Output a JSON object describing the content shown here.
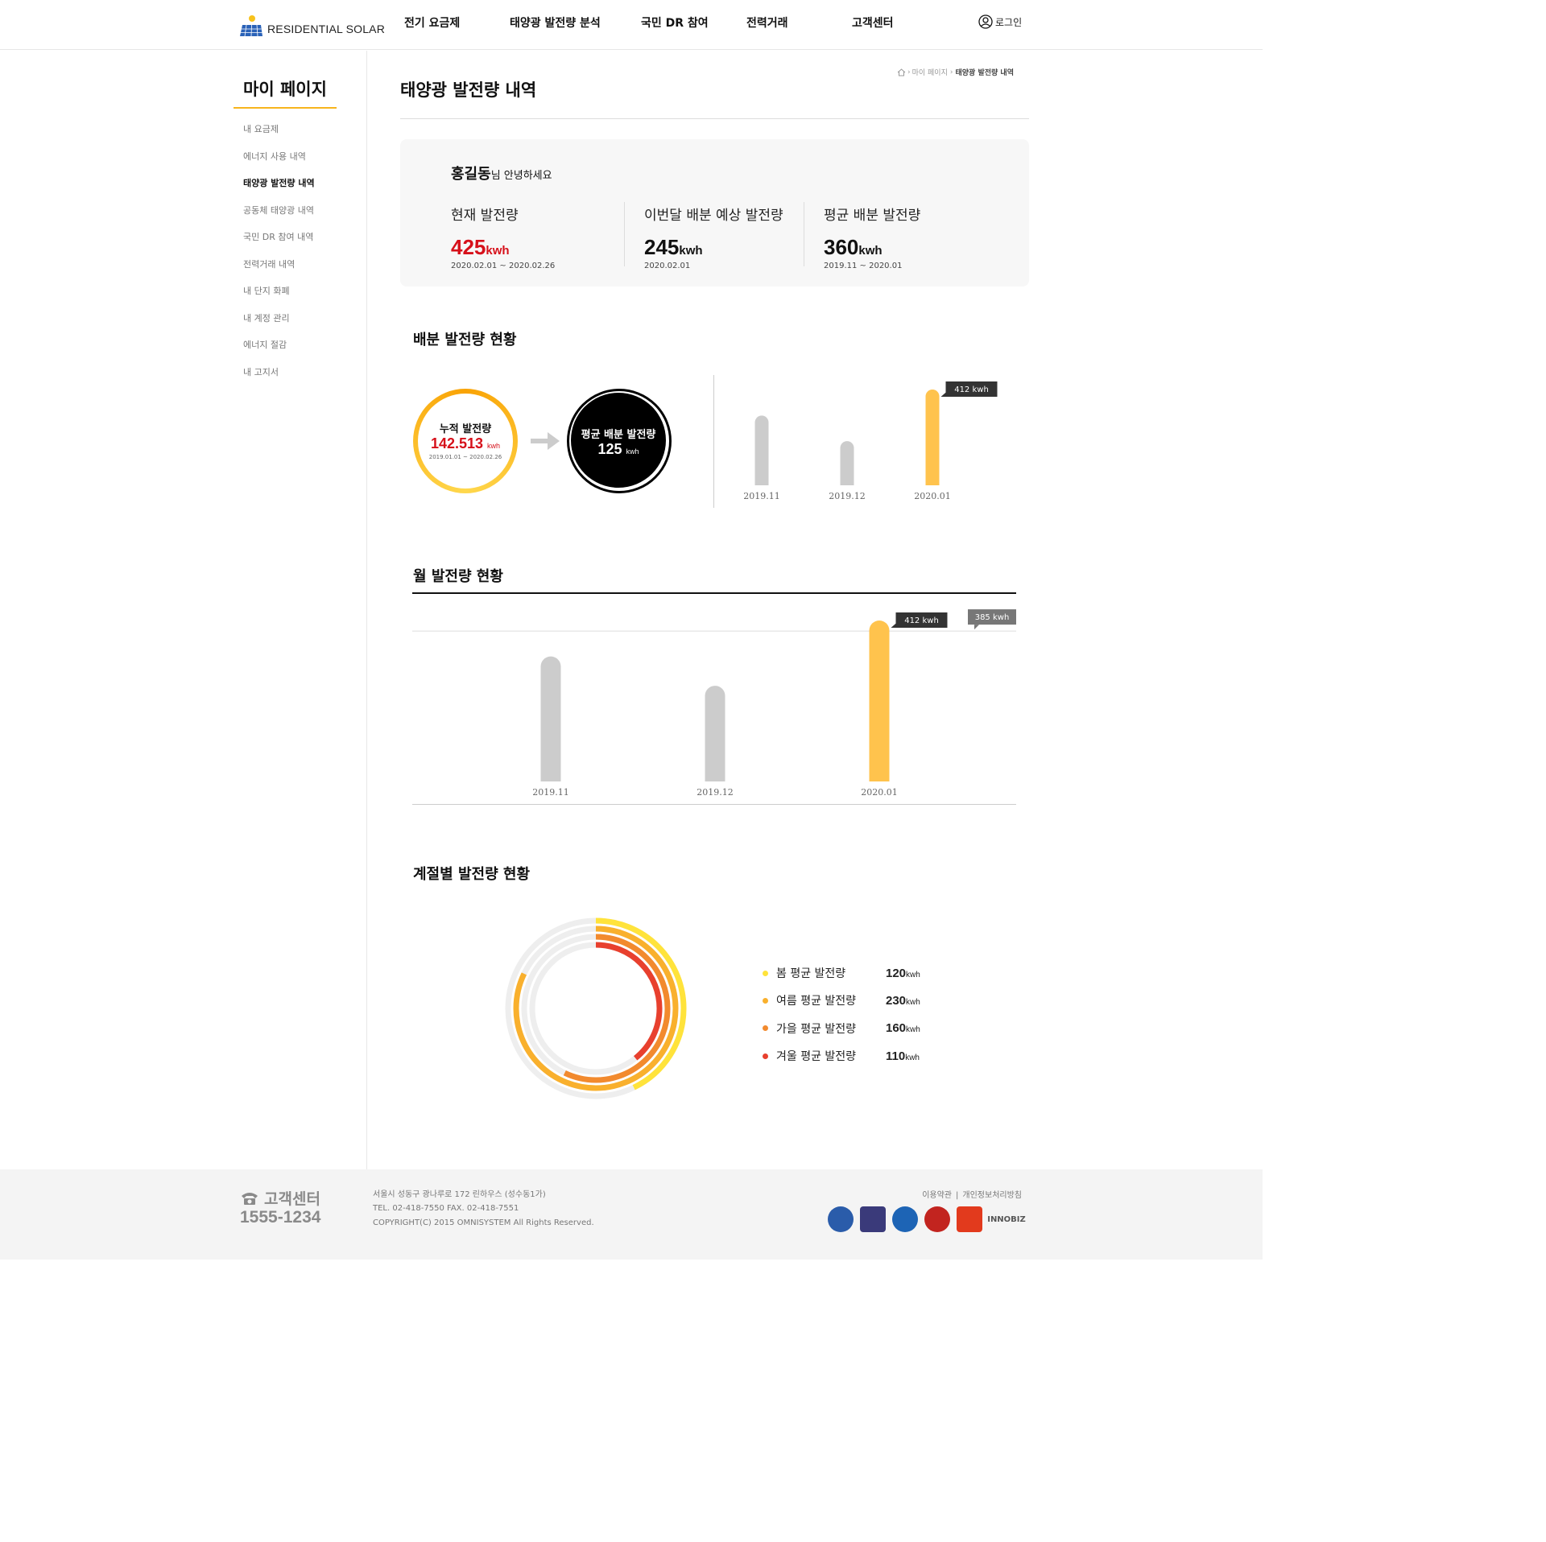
{
  "header": {
    "logo_text": "RESIDENTIAL SOLAR",
    "nav": [
      "전기 요금제",
      "태양광 발전량 분석",
      "국민 DR 참여",
      "전력거래",
      "고객센터"
    ],
    "login_label": "로그인"
  },
  "sidebar": {
    "title": "마이 페이지",
    "items": [
      {
        "label": "내 요금제"
      },
      {
        "label": "에너지 사용 내역"
      },
      {
        "label": "태양광 발전량 내역"
      },
      {
        "label": "공동체 태양광 내역"
      },
      {
        "label": "국민 DR 참여 내역"
      },
      {
        "label": "전력거래 내역"
      },
      {
        "label": "내 단지 화폐"
      },
      {
        "label": "내 계정 관리"
      },
      {
        "label": "에너지 절감"
      },
      {
        "label": "내 고지서"
      }
    ],
    "active_index": 2
  },
  "breadcrumb": {
    "parent": "마이 페이지",
    "current": "태양광 발전량 내역"
  },
  "page_title": "태양광 발전량 내역",
  "summary": {
    "user_name": "홍길동",
    "greeting": "님 안녕하세요",
    "stats": [
      {
        "label": "현재 발전량",
        "value": "425",
        "unit": "kwh",
        "date": "2020.02.01 ~ 2020.02.26",
        "color": "#d6101a"
      },
      {
        "label": "이번달 배분 예상 발전량",
        "value": "245",
        "unit": "kwh",
        "date": "2020.02.01",
        "color": "#111111"
      },
      {
        "label": "평균 배분 발전량",
        "value": "360",
        "unit": "kwh",
        "date": "2019.11 ~ 2020.01",
        "color": "#111111"
      }
    ]
  },
  "distribution": {
    "title": "배분 발전량 현황",
    "cumulative": {
      "label": "누적 발전량",
      "value": "142.513",
      "unit": "kwh",
      "date": "2019.01.01 ~ 2020.02.26"
    },
    "average": {
      "label": "평균 배분 발전량",
      "value": "125",
      "unit": "kwh"
    }
  },
  "monthly": {
    "title": "월 발전량 현황"
  },
  "seasonal": {
    "title": "계절별 발전량 현황",
    "items": [
      {
        "label": "봄 평균 발전량",
        "value": "120",
        "unit": "kwh",
        "color": "#ffe33b"
      },
      {
        "label": "여름 평균 발전량",
        "value": "230",
        "unit": "kwh",
        "color": "#f9b02d"
      },
      {
        "label": "가을 평균 발전량",
        "value": "160",
        "unit": "kwh",
        "color": "#f28a2e"
      },
      {
        "label": "겨울 평균 발전량",
        "value": "110",
        "unit": "kwh",
        "color": "#e8402e"
      }
    ]
  },
  "chart_data": [
    {
      "type": "bar",
      "categories": [
        "2019.11",
        "2019.12",
        "2020.01"
      ],
      "values": [
        300,
        190,
        412
      ],
      "highlight_index": 2,
      "highlight_label": "412 kwh",
      "colors": {
        "normal": "#cccccc",
        "highlight": "#ffc34d"
      }
    },
    {
      "type": "bar",
      "categories": [
        "2019.11",
        "2019.12",
        "2020.01"
      ],
      "values": [
        320,
        245,
        412
      ],
      "highlight_index": 2,
      "highlight_label": "412 kwh",
      "reference_line": {
        "value": 385,
        "label": "385 kwh"
      },
      "colors": {
        "normal": "#cccccc",
        "highlight": "#ffc34d"
      }
    },
    {
      "type": "pie",
      "series": [
        {
          "name": "봄 평균 발전량",
          "value": 120
        },
        {
          "name": "여름 평균 발전량",
          "value": 230
        },
        {
          "name": "가을 평균 발전량",
          "value": 160
        },
        {
          "name": "겨울 평균 발전량",
          "value": 110
        }
      ]
    }
  ],
  "footer": {
    "cs_label": "고객센터",
    "cs_phone": "1555-1234",
    "address": "서울시 성동구 광나루로 172 린하우스 (성수동1가)",
    "tel_fax": "TEL. 02-418-7550  FAX. 02-418-7551",
    "copyright": "COPYRIGHT(C) 2015 OMNISYSTEM All Rights Reserved.",
    "links": [
      "이용약관",
      "개인정보처리방침"
    ],
    "cert_labels": [
      "",
      "",
      "",
      "",
      "",
      "INNOBIZ"
    ]
  }
}
